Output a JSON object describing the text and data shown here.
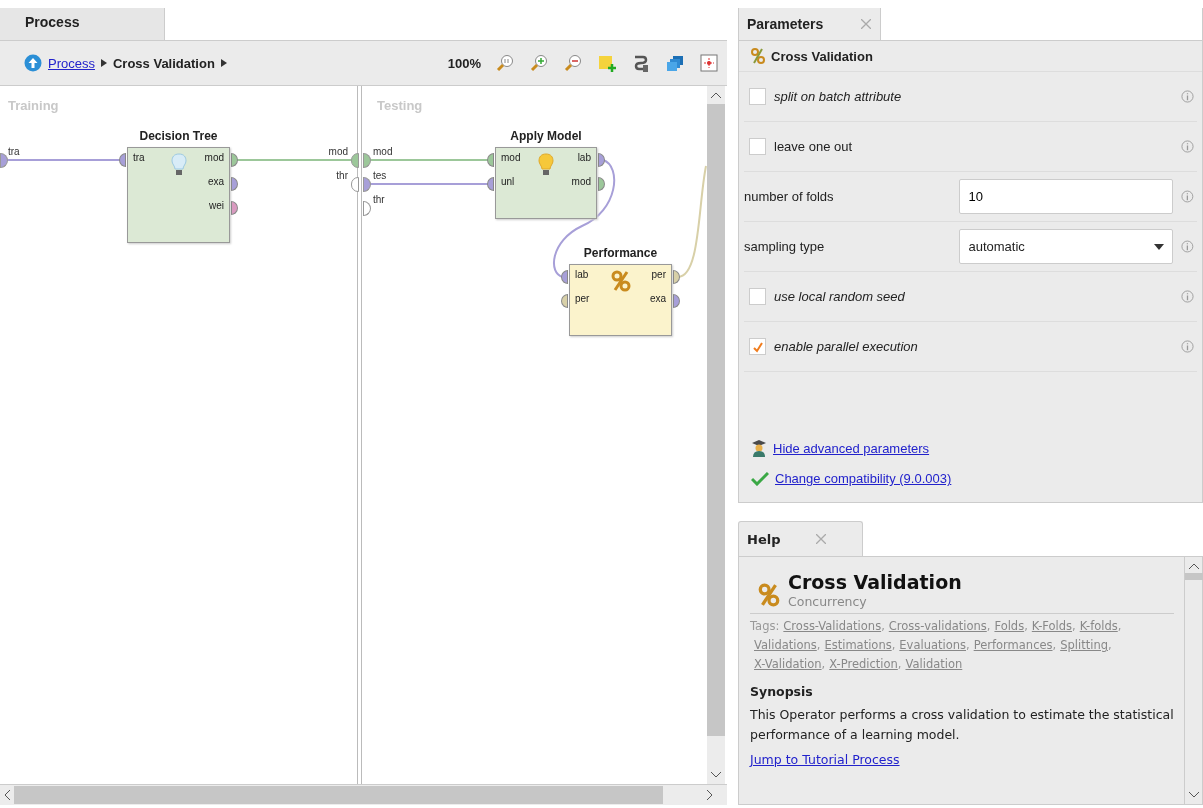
{
  "process_panel": {
    "tab": {
      "label": "Process",
      "selected": true
    },
    "breadcrumb": [
      {
        "label": "Process",
        "kind": "link"
      },
      {
        "label": "Cross Validation",
        "kind": "current"
      }
    ],
    "zoom": "100%",
    "subprocesses": [
      {
        "title": "Training",
        "inputs": [
          {
            "label": "tra",
            "color": "#a79fd8"
          }
        ],
        "outputs": [
          {
            "label": "mod",
            "color": "#9cc79a"
          },
          {
            "label": "thr",
            "color": "#ffffff"
          }
        ]
      },
      {
        "title": "Testing",
        "inputs": [
          {
            "label": "mod",
            "color": "#9cc79a"
          },
          {
            "label": "tes",
            "color": "#a79fd8"
          },
          {
            "label": "thr",
            "color": "#ffffff"
          }
        ]
      }
    ],
    "operators": [
      {
        "name": "Decision Tree",
        "kind": "learner",
        "color": "#dce9d5",
        "inputs": [
          {
            "label": "tra",
            "color": "#a79fd8"
          }
        ],
        "outputs": [
          {
            "label": "mod",
            "color": "#9cc79a"
          },
          {
            "label": "exa",
            "color": "#a79fd8"
          },
          {
            "label": "wei",
            "color": "#d99ac0"
          }
        ]
      },
      {
        "name": "Apply Model",
        "kind": "applier",
        "color": "#dce9d5",
        "inputs": [
          {
            "label": "mod",
            "color": "#9cc79a"
          },
          {
            "label": "unl",
            "color": "#a79fd8"
          }
        ],
        "outputs": [
          {
            "label": "lab",
            "color": "#a79fd8"
          },
          {
            "label": "mod",
            "color": "#9cc79a"
          }
        ]
      },
      {
        "name": "Performance",
        "kind": "evaluator",
        "color": "#fbf3cc",
        "inputs": [
          {
            "label": "lab",
            "color": "#a79fd8"
          },
          {
            "label": "per",
            "color": "#d8d0a8"
          }
        ],
        "outputs": [
          {
            "label": "per",
            "color": "#d8d0a8"
          },
          {
            "label": "exa",
            "color": "#a79fd8"
          }
        ]
      }
    ]
  },
  "parameters_panel": {
    "tab": {
      "label": "Parameters",
      "selected": true
    },
    "operator": "Cross Validation",
    "rows": [
      {
        "kind": "checkbox",
        "label": "split on batch attribute",
        "checked": false,
        "expert": true
      },
      {
        "kind": "checkbox",
        "label": "leave one out",
        "checked": false,
        "expert": false
      },
      {
        "kind": "number",
        "label": "number of folds",
        "value": "10"
      },
      {
        "kind": "select",
        "label": "sampling type",
        "value": "automatic"
      },
      {
        "kind": "checkbox",
        "label": "use local random seed",
        "checked": false,
        "expert": true
      },
      {
        "kind": "checkbox",
        "label": "enable parallel execution",
        "checked": true,
        "expert": true
      }
    ],
    "links": [
      {
        "kind": "advanced",
        "label": "Hide advanced parameters"
      },
      {
        "kind": "compatibility",
        "label": "Change compatibility (9.0.003)"
      }
    ]
  },
  "help_panel": {
    "tab": {
      "label": "Help",
      "selected": true
    },
    "title": "Cross Validation",
    "group": "Concurrency",
    "tags_label": "Tags:",
    "tags": [
      {
        "label": "Cross-Validations",
        "separator": ","
      },
      {
        "label": "Cross-validations",
        "separator": ","
      },
      {
        "label": "Folds",
        "separator": ","
      },
      {
        "label": "K-Folds",
        "separator": ","
      },
      {
        "label": "K-folds",
        "separator": ","
      },
      {
        "label": "Validations",
        "separator": ","
      },
      {
        "label": "Estimations",
        "separator": ","
      },
      {
        "label": "Evaluations",
        "separator": ","
      },
      {
        "label": "Performances",
        "separator": ","
      },
      {
        "label": "Splitting",
        "separator": ","
      },
      {
        "label": "X-Validation",
        "separator": ","
      },
      {
        "label": "X-Prediction",
        "separator": ","
      },
      {
        "label": "Validation"
      }
    ],
    "synopsis_heading": "Synopsis",
    "synopsis": "This Operator performs a cross validation to estimate the statistical performance of a learning model.",
    "tutorial_link": "Jump to Tutorial Process"
  }
}
